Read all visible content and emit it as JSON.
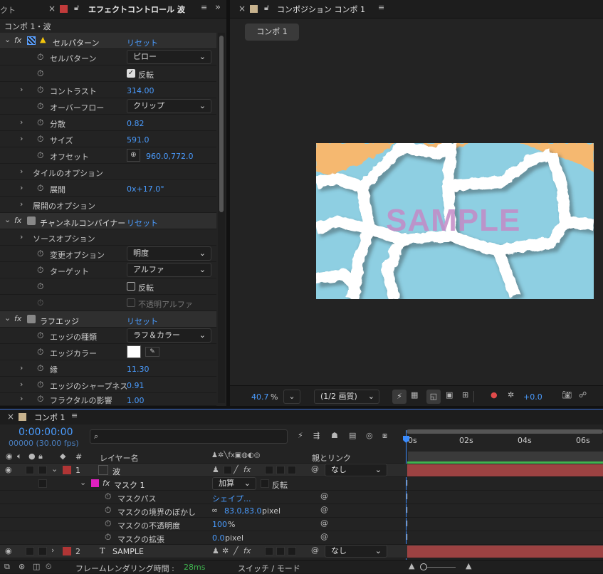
{
  "effect_panel": {
    "tab_left": "クト",
    "tab_title": "エフェクトコントロール 波",
    "breadcrumb": "コンポ 1・波",
    "reset": "リセット",
    "cell": {
      "name": "セルパターン",
      "pattern_label": "セルパターン",
      "pattern_value": "ピロー",
      "invert_label": "反転",
      "contrast_label": "コントラスト",
      "contrast_value": "314.00",
      "overflow_label": "オーバーフロー",
      "overflow_value": "クリップ",
      "disperse_label": "分散",
      "disperse_value": "0.82",
      "size_label": "サイズ",
      "size_value": "591.0",
      "offset_label": "オフセット",
      "offset_value": "960.0,772.0",
      "tile_options": "タイルのオプション",
      "evolution_label": "展開",
      "evolution_value": "0x+17.0°",
      "evolution_options": "展開のオプション"
    },
    "channel": {
      "name": "チャンネルコンバイナー",
      "source_options": "ソースオプション",
      "change_label": "変更オプション",
      "change_value": "明度",
      "target_label": "ターゲット",
      "target_value": "アルファ",
      "invert_label": "反転",
      "opaque_alpha_label": "不透明アルファ"
    },
    "rough": {
      "name": "ラフエッジ",
      "edge_type_label": "エッジの種類",
      "edge_type_value": "ラフ＆カラー",
      "edge_color_label": "エッジカラー",
      "border_label": "縁",
      "border_value": "11.30",
      "sharpness_label": "エッジのシャープネス",
      "sharpness_value": "0.91",
      "fractal_label": "フラクタルの影響",
      "fractal_value": "1.00"
    }
  },
  "comp_panel": {
    "tab_title": "コンポジション コンポ 1",
    "comp_button": "コンポ 1",
    "watermark": "SAMPLE",
    "zoom": "40.7",
    "zoom_unit": "%",
    "quality": "(1/2 画質)",
    "exposure": "+0.0"
  },
  "timeline": {
    "tab_title": "コンポ 1",
    "timecode": "0:00:00:00",
    "frames": "00000 (30.00 fps)",
    "search_placeholder": "",
    "col_layer_name": "レイヤー名",
    "col_parent": "親とリンク",
    "ruler": [
      "0s",
      "02s",
      "04s",
      "06s"
    ],
    "layers": [
      {
        "num": "1",
        "name": "波",
        "parent": "なし",
        "color": "#b03535"
      },
      {
        "num": "2",
        "name": "SAMPLE",
        "parent": "なし",
        "color": "#b03535",
        "type_icon": "T"
      }
    ],
    "mask": {
      "name": "マスク 1",
      "mode": "加算",
      "invert": "反転",
      "path_label": "マスクパス",
      "path_value": "シェイプ...",
      "feather_label": "マスクの境界のぼかし",
      "feather_value": "83.0,83.0",
      "feather_unit": " pixel",
      "opacity_label": "マスクの不透明度",
      "opacity_value": "100",
      "opacity_unit": "%",
      "expansion_label": "マスクの拡張",
      "expansion_value": "0.0",
      "expansion_unit": " pixel"
    },
    "footer_render_label": "フレームレンダリング時間 :",
    "footer_render_value": "28ms",
    "footer_mode": "スイッチ / モード"
  },
  "colors": {
    "accent_blue": "#4a9cff",
    "layer_red": "#b03535",
    "mask_pink": "#e020c0",
    "track_green": "#3fb34f",
    "cell_blue": "#8ecfe2",
    "cell_orange": "#f5b870"
  }
}
